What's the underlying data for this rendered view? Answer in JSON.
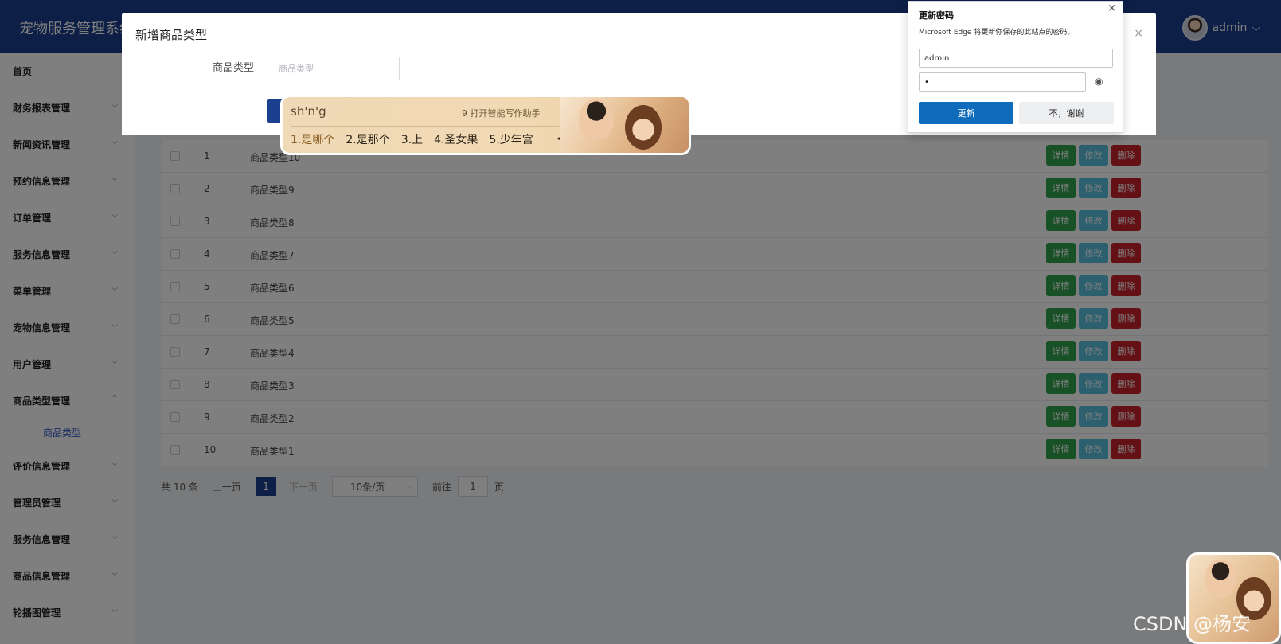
{
  "header": {
    "app_title": "宠物服务管理系统",
    "user_name": "admin",
    "user_chevron": "⌵"
  },
  "sidebar": {
    "items": [
      {
        "label": "首页",
        "chevron": ""
      },
      {
        "label": "财务报表管理",
        "chevron": "⌵"
      },
      {
        "label": "新闻资讯管理",
        "chevron": "⌵"
      },
      {
        "label": "预约信息管理",
        "chevron": "⌵"
      },
      {
        "label": "订单管理",
        "chevron": "⌵"
      },
      {
        "label": "服务信息管理",
        "chevron": "⌵"
      },
      {
        "label": "菜单管理",
        "chevron": "⌵"
      },
      {
        "label": "宠物信息管理",
        "chevron": "⌵"
      },
      {
        "label": "用户管理",
        "chevron": "⌵"
      },
      {
        "label": "商品类型管理",
        "chevron": "^"
      },
      {
        "label": "评价信息管理",
        "chevron": "⌵"
      },
      {
        "label": "管理员管理",
        "chevron": "⌵"
      },
      {
        "label": "服务信息管理",
        "chevron": "⌵"
      },
      {
        "label": "商品信息管理",
        "chevron": "⌵"
      },
      {
        "label": "轮播图管理",
        "chevron": "⌵"
      }
    ],
    "submenu_label": "商品类型"
  },
  "table": {
    "actions": {
      "detail": "详情",
      "edit": "修改",
      "delete": "删除"
    },
    "rows": [
      {
        "index": "1",
        "name": "商品类型10"
      },
      {
        "index": "2",
        "name": "商品类型9"
      },
      {
        "index": "3",
        "name": "商品类型8"
      },
      {
        "index": "4",
        "name": "商品类型7"
      },
      {
        "index": "5",
        "name": "商品类型6"
      },
      {
        "index": "6",
        "name": "商品类型5"
      },
      {
        "index": "7",
        "name": "商品类型4"
      },
      {
        "index": "8",
        "name": "商品类型3"
      },
      {
        "index": "9",
        "name": "商品类型2"
      },
      {
        "index": "10",
        "name": "商品类型1"
      }
    ]
  },
  "pagination": {
    "total": "共 10 条",
    "prev": "上一页",
    "current_page": "1",
    "next": "下一页",
    "page_size": "10条/页",
    "goto_label": "前往",
    "goto_value": "1",
    "page_suffix": "页"
  },
  "dialog": {
    "title": "新增商品类型",
    "close_symbol": "×",
    "field_label": "商品类型",
    "field_placeholder": "商品类型"
  },
  "ime": {
    "composition": "sh'n'g",
    "hint": "9 打开智能写作助手",
    "candidates": [
      "1.是哪个",
      "2.是那个",
      "3.上",
      "4.圣女果",
      "5.少年宫"
    ],
    "arrows": "◀ ▶ ▾"
  },
  "edge_popup": {
    "title": "更新密码",
    "description": "Microsoft Edge 将更新你保存的此站点的密码。",
    "username": "admin",
    "password": "•",
    "update_label": "更新",
    "dismiss_label": "不，谢谢",
    "close_symbol": "×",
    "eye_symbol": "◉"
  },
  "watermark": "CSDN @杨安",
  "colors": {
    "header_bg": "#1d3f8f",
    "detail_btn": "#2fa34a",
    "edit_btn": "#5bc0de",
    "delete_btn": "#c8232c",
    "edge_primary": "#0f6cbd"
  }
}
